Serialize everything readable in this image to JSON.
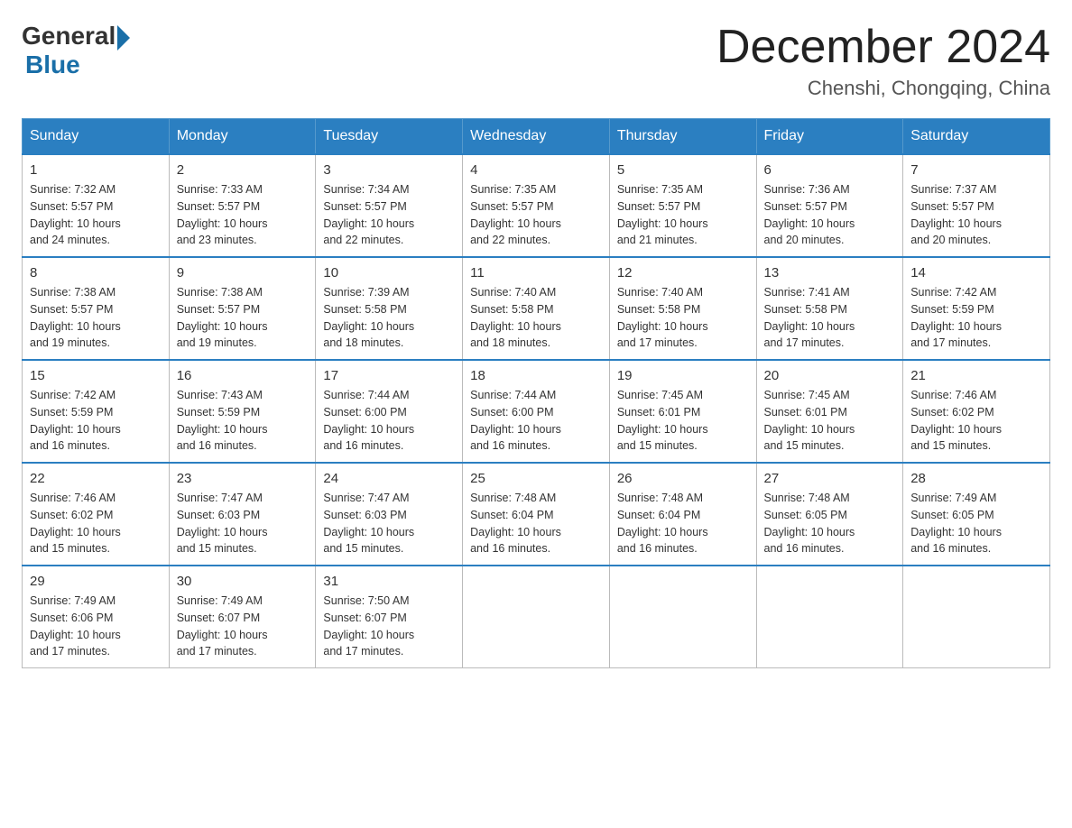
{
  "header": {
    "logo_general": "General",
    "logo_blue": "Blue",
    "month_title": "December 2024",
    "location": "Chenshi, Chongqing, China"
  },
  "days_of_week": [
    "Sunday",
    "Monday",
    "Tuesday",
    "Wednesday",
    "Thursday",
    "Friday",
    "Saturday"
  ],
  "weeks": [
    [
      {
        "day": "1",
        "sunrise": "7:32 AM",
        "sunset": "5:57 PM",
        "daylight": "10 hours and 24 minutes."
      },
      {
        "day": "2",
        "sunrise": "7:33 AM",
        "sunset": "5:57 PM",
        "daylight": "10 hours and 23 minutes."
      },
      {
        "day": "3",
        "sunrise": "7:34 AM",
        "sunset": "5:57 PM",
        "daylight": "10 hours and 22 minutes."
      },
      {
        "day": "4",
        "sunrise": "7:35 AM",
        "sunset": "5:57 PM",
        "daylight": "10 hours and 22 minutes."
      },
      {
        "day": "5",
        "sunrise": "7:35 AM",
        "sunset": "5:57 PM",
        "daylight": "10 hours and 21 minutes."
      },
      {
        "day": "6",
        "sunrise": "7:36 AM",
        "sunset": "5:57 PM",
        "daylight": "10 hours and 20 minutes."
      },
      {
        "day": "7",
        "sunrise": "7:37 AM",
        "sunset": "5:57 PM",
        "daylight": "10 hours and 20 minutes."
      }
    ],
    [
      {
        "day": "8",
        "sunrise": "7:38 AM",
        "sunset": "5:57 PM",
        "daylight": "10 hours and 19 minutes."
      },
      {
        "day": "9",
        "sunrise": "7:38 AM",
        "sunset": "5:57 PM",
        "daylight": "10 hours and 19 minutes."
      },
      {
        "day": "10",
        "sunrise": "7:39 AM",
        "sunset": "5:58 PM",
        "daylight": "10 hours and 18 minutes."
      },
      {
        "day": "11",
        "sunrise": "7:40 AM",
        "sunset": "5:58 PM",
        "daylight": "10 hours and 18 minutes."
      },
      {
        "day": "12",
        "sunrise": "7:40 AM",
        "sunset": "5:58 PM",
        "daylight": "10 hours and 17 minutes."
      },
      {
        "day": "13",
        "sunrise": "7:41 AM",
        "sunset": "5:58 PM",
        "daylight": "10 hours and 17 minutes."
      },
      {
        "day": "14",
        "sunrise": "7:42 AM",
        "sunset": "5:59 PM",
        "daylight": "10 hours and 17 minutes."
      }
    ],
    [
      {
        "day": "15",
        "sunrise": "7:42 AM",
        "sunset": "5:59 PM",
        "daylight": "10 hours and 16 minutes."
      },
      {
        "day": "16",
        "sunrise": "7:43 AM",
        "sunset": "5:59 PM",
        "daylight": "10 hours and 16 minutes."
      },
      {
        "day": "17",
        "sunrise": "7:44 AM",
        "sunset": "6:00 PM",
        "daylight": "10 hours and 16 minutes."
      },
      {
        "day": "18",
        "sunrise": "7:44 AM",
        "sunset": "6:00 PM",
        "daylight": "10 hours and 16 minutes."
      },
      {
        "day": "19",
        "sunrise": "7:45 AM",
        "sunset": "6:01 PM",
        "daylight": "10 hours and 15 minutes."
      },
      {
        "day": "20",
        "sunrise": "7:45 AM",
        "sunset": "6:01 PM",
        "daylight": "10 hours and 15 minutes."
      },
      {
        "day": "21",
        "sunrise": "7:46 AM",
        "sunset": "6:02 PM",
        "daylight": "10 hours and 15 minutes."
      }
    ],
    [
      {
        "day": "22",
        "sunrise": "7:46 AM",
        "sunset": "6:02 PM",
        "daylight": "10 hours and 15 minutes."
      },
      {
        "day": "23",
        "sunrise": "7:47 AM",
        "sunset": "6:03 PM",
        "daylight": "10 hours and 15 minutes."
      },
      {
        "day": "24",
        "sunrise": "7:47 AM",
        "sunset": "6:03 PM",
        "daylight": "10 hours and 15 minutes."
      },
      {
        "day": "25",
        "sunrise": "7:48 AM",
        "sunset": "6:04 PM",
        "daylight": "10 hours and 16 minutes."
      },
      {
        "day": "26",
        "sunrise": "7:48 AM",
        "sunset": "6:04 PM",
        "daylight": "10 hours and 16 minutes."
      },
      {
        "day": "27",
        "sunrise": "7:48 AM",
        "sunset": "6:05 PM",
        "daylight": "10 hours and 16 minutes."
      },
      {
        "day": "28",
        "sunrise": "7:49 AM",
        "sunset": "6:05 PM",
        "daylight": "10 hours and 16 minutes."
      }
    ],
    [
      {
        "day": "29",
        "sunrise": "7:49 AM",
        "sunset": "6:06 PM",
        "daylight": "10 hours and 17 minutes."
      },
      {
        "day": "30",
        "sunrise": "7:49 AM",
        "sunset": "6:07 PM",
        "daylight": "10 hours and 17 minutes."
      },
      {
        "day": "31",
        "sunrise": "7:50 AM",
        "sunset": "6:07 PM",
        "daylight": "10 hours and 17 minutes."
      },
      null,
      null,
      null,
      null
    ]
  ],
  "labels": {
    "sunrise": "Sunrise:",
    "sunset": "Sunset:",
    "daylight": "Daylight:"
  }
}
